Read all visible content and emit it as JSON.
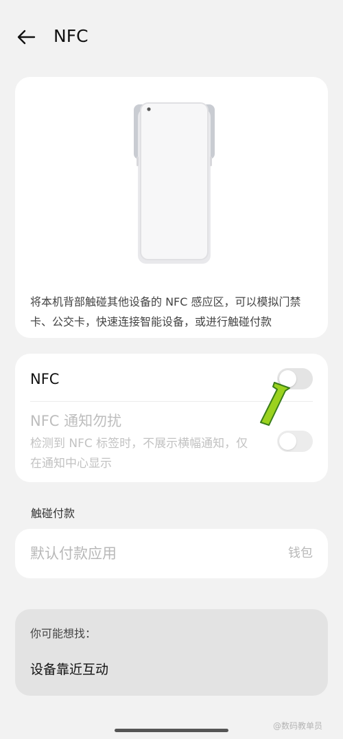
{
  "header": {
    "back_icon": "back-arrow-icon",
    "title": "NFC"
  },
  "illustration": {
    "icon": "phone-nfc-illustration",
    "description": "将本机背部触碰其他设备的 NFC 感应区，可以模拟门禁卡、公交卡，快速连接智能设备，或进行触碰付款"
  },
  "nfc_settings": {
    "nfc_label": "NFC",
    "nfc_toggle_on": false,
    "dnd_title": "NFC 通知勿扰",
    "dnd_description": "检测到 NFC 标签时，不展示横幅通知，仅在通知中心显示",
    "dnd_toggle_on": false
  },
  "payment": {
    "section_label": "触碰付款",
    "default_app_label": "默认付款应用",
    "default_app_value": "钱包"
  },
  "suggestions": {
    "label": "你可能想找：",
    "items": [
      "设备靠近互动"
    ]
  },
  "watermark": "@数码教单员",
  "colors": {
    "background": "#f2f2f2",
    "card": "#ffffff",
    "toggle_off": "#e4e4e4",
    "annotation_arrow": "#9bd21e"
  }
}
